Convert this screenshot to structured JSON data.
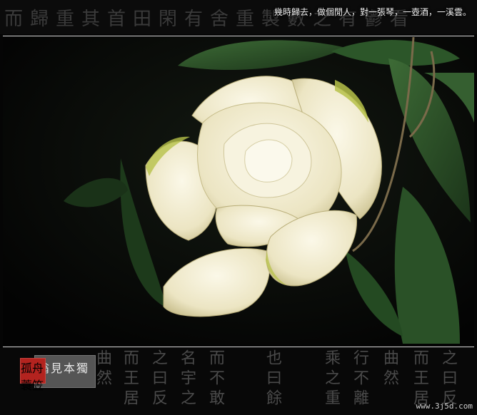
{
  "caption": "幾時歸去，做個閒人，對一張琴，一壺酒，一溪雲。",
  "watermark": "www.3j5d.com",
  "seal_text": "孤舟蓑笠",
  "signature_text": "翁見本獨",
  "colors": {
    "background": "#050505",
    "petal": "#f1ecd4",
    "petal_shadow": "#cfc69a",
    "petal_tip": "#b7c24a",
    "leaf": "#2f5a2c",
    "leaf_dark": "#173018",
    "seal": "#b3231f"
  }
}
